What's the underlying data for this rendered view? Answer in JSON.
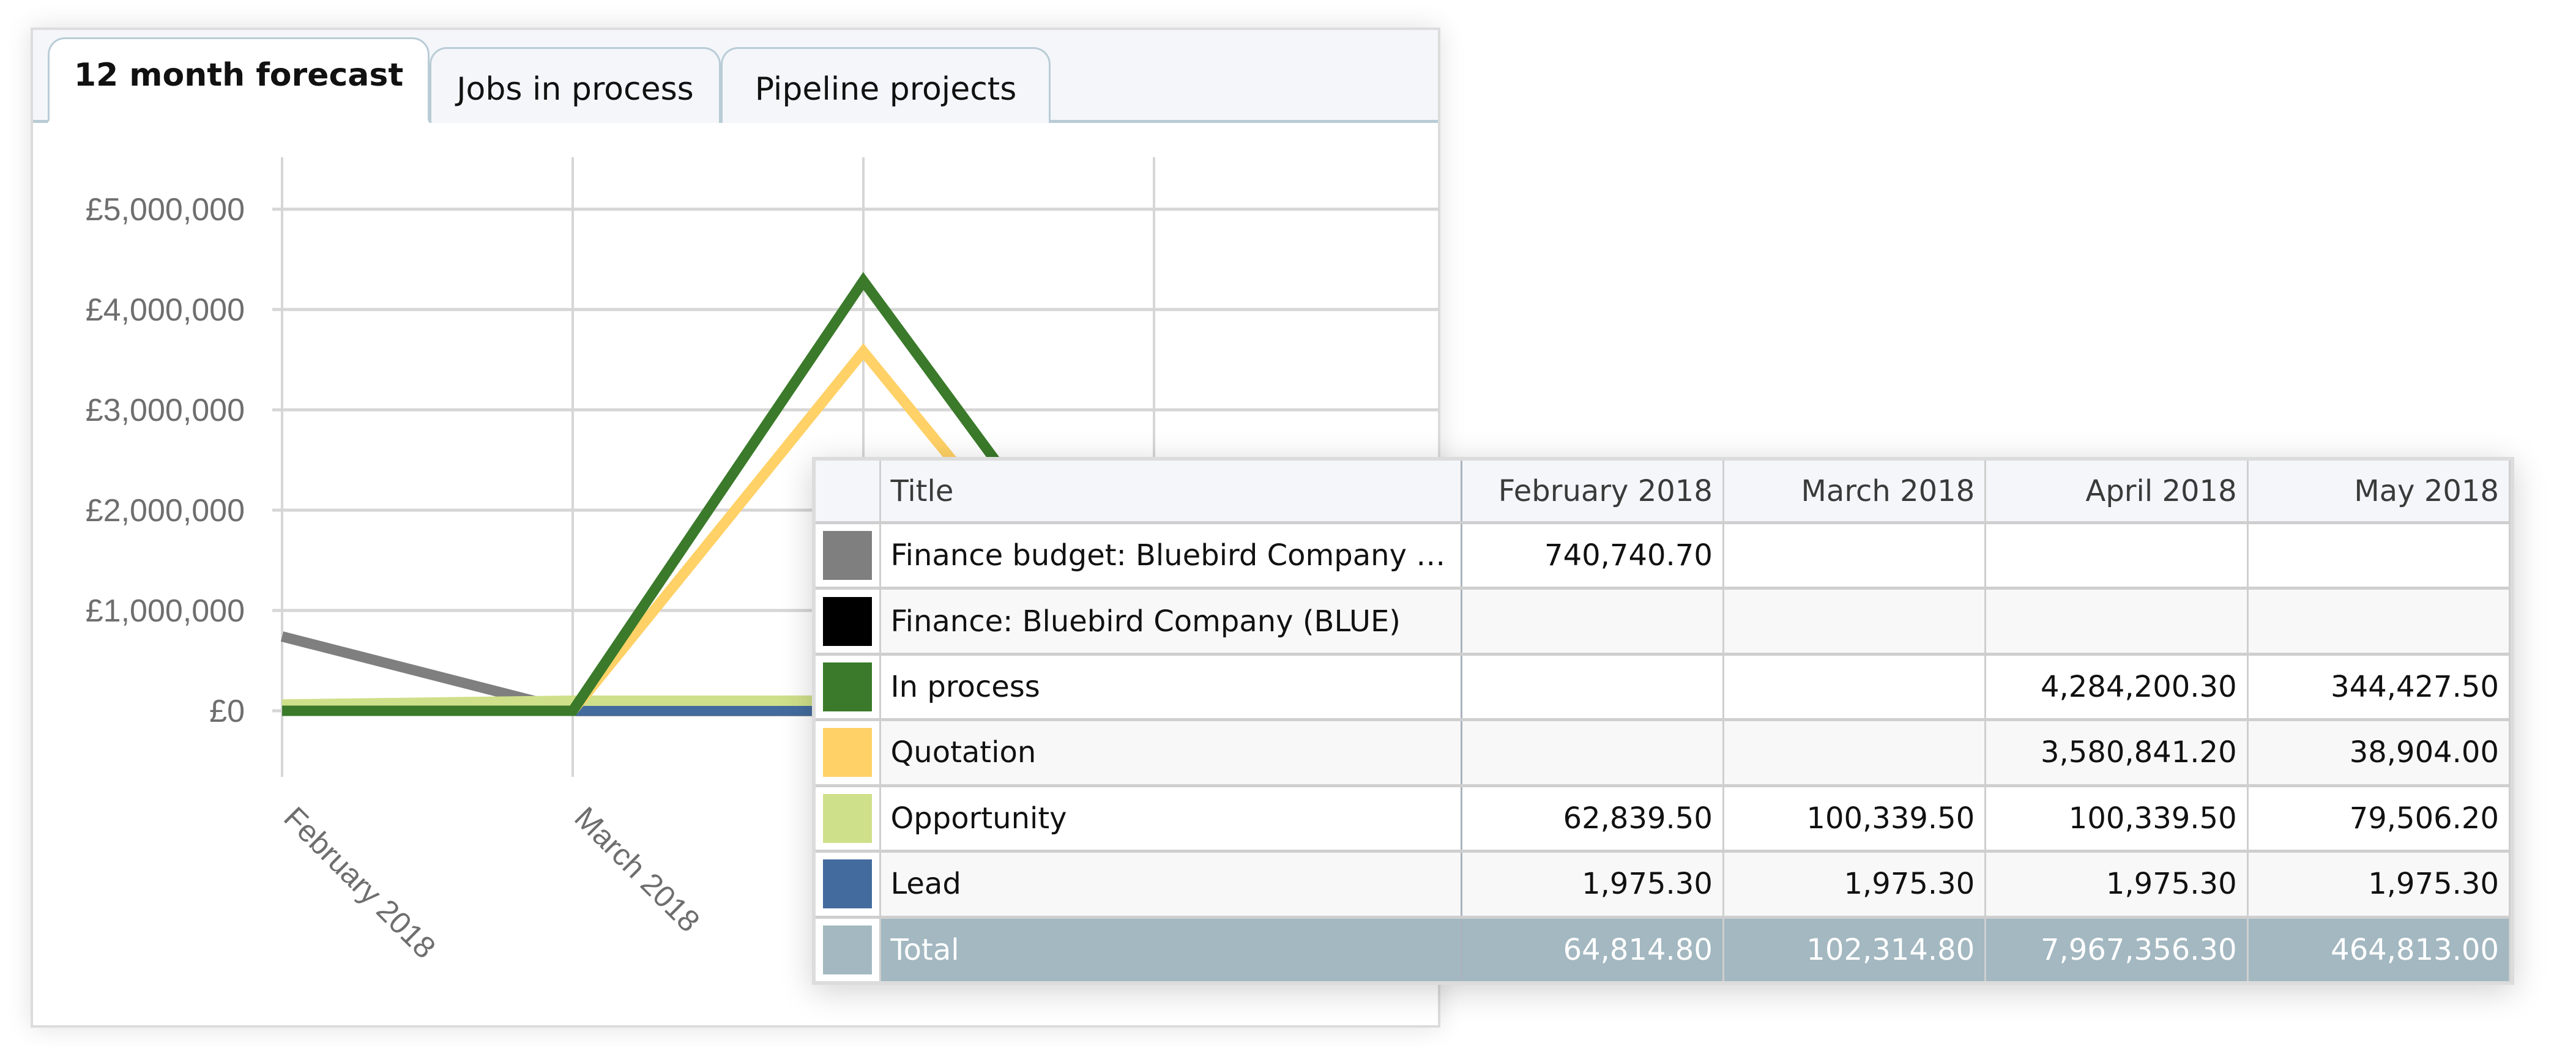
{
  "tabs": [
    {
      "label": "12 month forecast",
      "active": true
    },
    {
      "label": "Jobs in process",
      "active": false
    },
    {
      "label": "Pipeline projects",
      "active": false
    }
  ],
  "table": {
    "headers": [
      "",
      "Title",
      "February 2018",
      "March 2018",
      "April 2018",
      "May 2018"
    ],
    "rows": [
      {
        "color": "#7f7f7f",
        "title": "Finance budget: Bluebird Company (...",
        "values": [
          "740,740.70",
          "",
          "",
          ""
        ]
      },
      {
        "color": "#000000",
        "title": "Finance: Bluebird Company (BLUE)",
        "values": [
          "",
          "",
          "",
          ""
        ]
      },
      {
        "color": "#3a7a2a",
        "title": "In process",
        "values": [
          "",
          "",
          "4,284,200.30",
          "344,427.50"
        ]
      },
      {
        "color": "#ffd166",
        "title": "Quotation",
        "values": [
          "",
          "",
          "3,580,841.20",
          "38,904.00"
        ]
      },
      {
        "color": "#cfe08a",
        "title": "Opportunity",
        "values": [
          "62,839.50",
          "100,339.50",
          "100,339.50",
          "79,506.20"
        ]
      },
      {
        "color": "#436b9e",
        "title": "Lead",
        "values": [
          "1,975.30",
          "1,975.30",
          "1,975.30",
          "1,975.30"
        ]
      }
    ],
    "total": {
      "color": "#a3b8c1",
      "title": "Total",
      "values": [
        "64,814.80",
        "102,314.80",
        "7,967,356.30",
        "464,813.00"
      ]
    }
  },
  "chart_data": {
    "type": "line",
    "title": "",
    "xlabel": "",
    "ylabel": "",
    "categories": [
      "February 2018",
      "March 2018",
      "April 2018",
      "May 2018"
    ],
    "visible_x_tick_labels": [
      "February 2018",
      "March 2018"
    ],
    "y_ticks": [
      0,
      1000000,
      2000000,
      3000000,
      4000000,
      5000000
    ],
    "y_tick_labels": [
      "£0",
      "£1,000,000",
      "£2,000,000",
      "£3,000,000",
      "£4,000,000",
      "£5,000,000"
    ],
    "ylim": [
      0,
      5000000
    ],
    "grid": true,
    "series": [
      {
        "name": "Finance budget: Bluebird Company",
        "color": "#7f7f7f",
        "values": [
          740740.7,
          0,
          0,
          0
        ]
      },
      {
        "name": "Finance: Bluebird Company (BLUE)",
        "color": "#000000",
        "values": [
          0,
          0,
          0,
          0
        ]
      },
      {
        "name": "Lead",
        "color": "#436b9e",
        "values": [
          1975.3,
          1975.3,
          1975.3,
          1975.3
        ]
      },
      {
        "name": "Opportunity",
        "color": "#cfe08a",
        "values": [
          62839.5,
          100339.5,
          100339.5,
          79506.2
        ]
      },
      {
        "name": "Quotation",
        "color": "#ffd166",
        "values": [
          0,
          0,
          3580841.2,
          38904.0
        ]
      },
      {
        "name": "In process",
        "color": "#3a7a2a",
        "values": [
          0,
          0,
          4284200.3,
          344427.5
        ]
      }
    ]
  }
}
